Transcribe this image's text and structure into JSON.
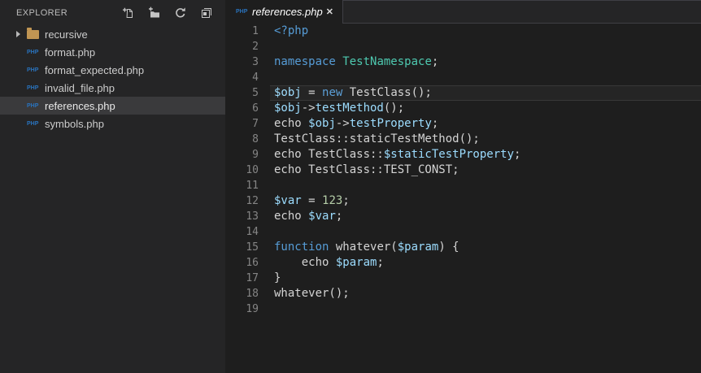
{
  "colors": {
    "editor_bg": "#1e1e1e",
    "sidebar_bg": "#252526",
    "selected_row_bg": "#3a3a3c",
    "current_line_border": "rgba(255,255,255,0.09)",
    "keyword": "#569cd6",
    "class_name": "#4ec9b0",
    "variable": "#9cdcfe",
    "number": "#b5cea8",
    "plain_code": "#d4d4d4",
    "line_number": "#858585",
    "php_icon_blue": "#2973be",
    "folder_tan": "#c09553"
  },
  "sidebar": {
    "title": "EXPLORER",
    "actions": [
      {
        "name": "new-file"
      },
      {
        "name": "new-folder"
      },
      {
        "name": "refresh-explorer"
      },
      {
        "name": "collapse-folders"
      }
    ],
    "files": [
      {
        "label": "recursive",
        "kind": "folder",
        "collapsed": true,
        "selected": false
      },
      {
        "label": "format.php",
        "kind": "php",
        "selected": false
      },
      {
        "label": "format_expected.php",
        "kind": "php",
        "selected": false
      },
      {
        "label": "invalid_file.php",
        "kind": "php",
        "selected": false
      },
      {
        "label": "references.php",
        "kind": "php",
        "selected": true
      },
      {
        "label": "symbols.php",
        "kind": "php",
        "selected": false
      }
    ]
  },
  "icons": {
    "php_label": "PHP"
  },
  "tabs": [
    {
      "label": "references.php",
      "icon": "php",
      "close_glyph": "✕",
      "active": true,
      "preview_italic": true
    }
  ],
  "editor": {
    "current_line": 5,
    "lines": [
      {
        "n": 1,
        "tokens": [
          {
            "t": "<?php",
            "c": "k"
          }
        ]
      },
      {
        "n": 2,
        "tokens": []
      },
      {
        "n": 3,
        "tokens": [
          {
            "t": "namespace",
            "c": "k"
          },
          {
            "t": " ",
            "c": "p"
          },
          {
            "t": "TestNamespace",
            "c": "t"
          },
          {
            "t": ";",
            "c": "p"
          }
        ]
      },
      {
        "n": 4,
        "tokens": []
      },
      {
        "n": 5,
        "tokens": [
          {
            "t": "$obj",
            "c": "v"
          },
          {
            "t": " = ",
            "c": "p"
          },
          {
            "t": "new",
            "c": "k"
          },
          {
            "t": " TestClass();",
            "c": "p"
          }
        ]
      },
      {
        "n": 6,
        "tokens": [
          {
            "t": "$obj",
            "c": "v"
          },
          {
            "t": "->",
            "c": "p"
          },
          {
            "t": "testMethod",
            "c": "v"
          },
          {
            "t": "();",
            "c": "p"
          }
        ]
      },
      {
        "n": 7,
        "tokens": [
          {
            "t": "echo ",
            "c": "p"
          },
          {
            "t": "$obj",
            "c": "v"
          },
          {
            "t": "->",
            "c": "p"
          },
          {
            "t": "testProperty",
            "c": "v"
          },
          {
            "t": ";",
            "c": "p"
          }
        ]
      },
      {
        "n": 8,
        "tokens": [
          {
            "t": "TestClass::staticTestMethod();",
            "c": "p"
          }
        ]
      },
      {
        "n": 9,
        "tokens": [
          {
            "t": "echo TestClass::",
            "c": "p"
          },
          {
            "t": "$staticTestProperty",
            "c": "v"
          },
          {
            "t": ";",
            "c": "p"
          }
        ]
      },
      {
        "n": 10,
        "tokens": [
          {
            "t": "echo TestClass::TEST_CONST;",
            "c": "p"
          }
        ]
      },
      {
        "n": 11,
        "tokens": []
      },
      {
        "n": 12,
        "tokens": [
          {
            "t": "$var",
            "c": "v"
          },
          {
            "t": " = ",
            "c": "p"
          },
          {
            "t": "123",
            "c": "n"
          },
          {
            "t": ";",
            "c": "p"
          }
        ]
      },
      {
        "n": 13,
        "tokens": [
          {
            "t": "echo ",
            "c": "p"
          },
          {
            "t": "$var",
            "c": "v"
          },
          {
            "t": ";",
            "c": "p"
          }
        ]
      },
      {
        "n": 14,
        "tokens": []
      },
      {
        "n": 15,
        "tokens": [
          {
            "t": "function",
            "c": "k"
          },
          {
            "t": " whatever(",
            "c": "p"
          },
          {
            "t": "$param",
            "c": "v"
          },
          {
            "t": ") {",
            "c": "p"
          }
        ]
      },
      {
        "n": 16,
        "tokens": [
          {
            "t": "    echo ",
            "c": "p"
          },
          {
            "t": "$param",
            "c": "v"
          },
          {
            "t": ";",
            "c": "p"
          }
        ]
      },
      {
        "n": 17,
        "tokens": [
          {
            "t": "}",
            "c": "p"
          }
        ]
      },
      {
        "n": 18,
        "tokens": [
          {
            "t": "whatever();",
            "c": "p"
          }
        ]
      },
      {
        "n": 19,
        "tokens": []
      }
    ]
  }
}
